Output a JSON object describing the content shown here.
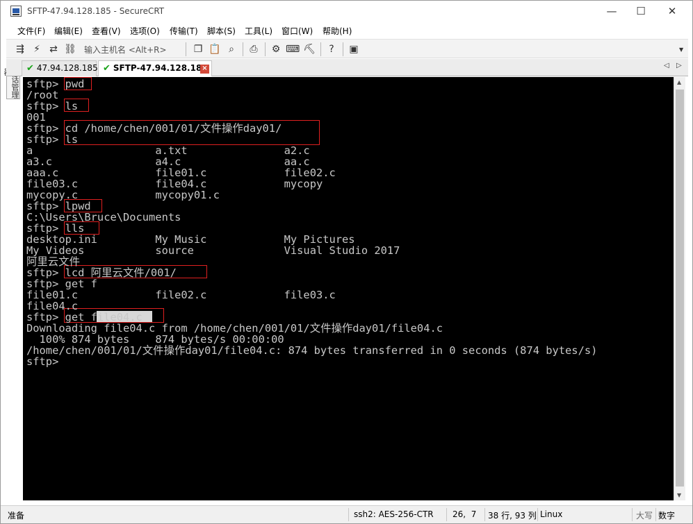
{
  "window": {
    "title": "SFTP-47.94.128.185 - SecureCRT",
    "minimize": "—",
    "maximize": "☐",
    "close": "✕"
  },
  "menu": [
    "文件(F)",
    "编辑(E)",
    "查看(V)",
    "选项(O)",
    "传输(T)",
    "脚本(S)",
    "工具(L)",
    "窗口(W)",
    "帮助(H)"
  ],
  "toolbar": {
    "connect_placeholder": "输入主机名 <Alt+R>",
    "icons": [
      "connect-icon",
      "quick-connect-icon",
      "reconnect-icon",
      "disconnect-icon",
      "copy-icon",
      "paste-icon",
      "find-icon",
      "print-icon",
      "settings-icon",
      "keymap-icon",
      "sftp-icon",
      "help-icon",
      "script-icon"
    ]
  },
  "tabs": [
    {
      "label": "47.94.128.185",
      "active": false
    },
    {
      "label": "SFTP-47.94.128.185",
      "active": true
    }
  ],
  "side_panel": {
    "label": "会话管理器"
  },
  "terminal": {
    "lines": [
      "sftp> pwd",
      "/root",
      "sftp> ls",
      "001",
      "sftp> cd /home/chen/001/01/文件操作day01/",
      "sftp> ls",
      "a                   a.txt               a2.c",
      "a3.c                a4.c                aa.c",
      "aaa.c               file01.c            file02.c",
      "file03.c            file04.c            mycopy",
      "mycopy.c            mycopy01.c",
      "sftp> lpwd",
      "C:\\Users\\Bruce\\Documents",
      "sftp> lls",
      "desktop.ini         My Music            My Pictures",
      "My Videos           source              Visual Studio 2017",
      "阿里云文件",
      "sftp> lcd 阿里云文件/001/",
      "sftp> get f",
      "file01.c            file02.c            file03.c",
      "file04.c",
      "sftp> get file04.c",
      "Downloading file04.c from /home/chen/001/01/文件操作day01/file04.c",
      "  100% 874 bytes    874 bytes/s 00:00:00",
      "/home/chen/001/01/文件操作day01/file04.c: 874 bytes transferred in 0 seconds (874 bytes/s)",
      "sftp>"
    ],
    "text_color": "#c8c8c8",
    "background": "#000000",
    "highlight_color": "#e02020"
  },
  "status": {
    "ready": "准备",
    "encryption": "ssh2: AES-256-CTR",
    "cursor": "26,  7",
    "size": "38 行, 93 列",
    "terminal_type": "Linux",
    "caps": "大写",
    "num": "数字"
  }
}
